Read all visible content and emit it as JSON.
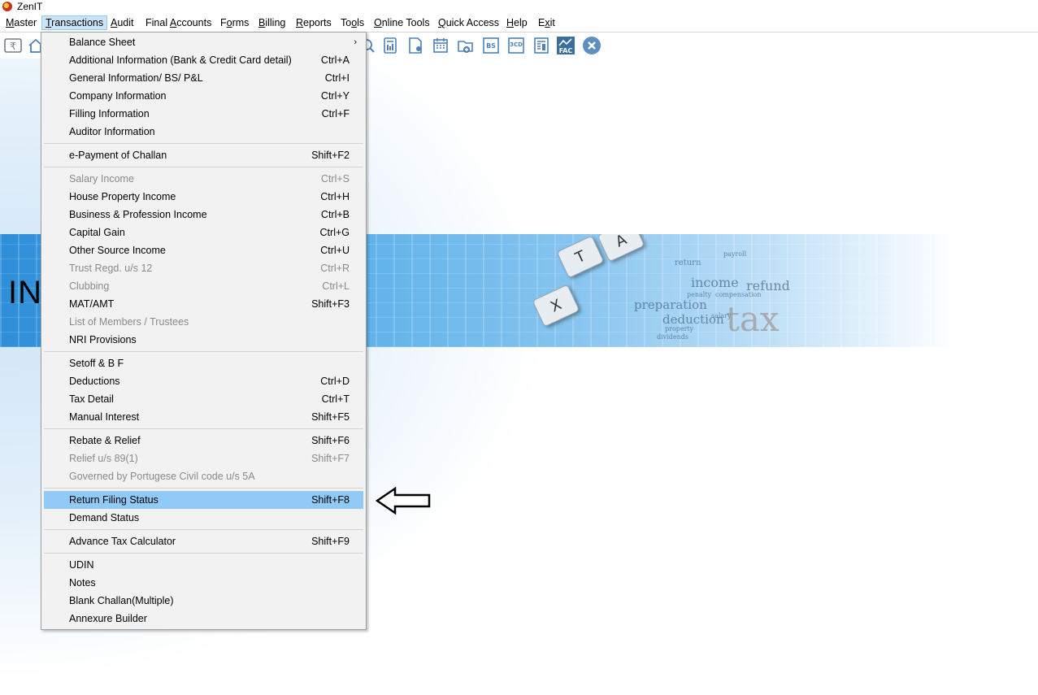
{
  "window": {
    "title": "ZenIT"
  },
  "menubar": [
    {
      "label": "Master",
      "u": "M"
    },
    {
      "label": "Transactions",
      "u": "T"
    },
    {
      "label": "Audit",
      "u": "A"
    },
    {
      "label": "Final Accounts",
      "u": "A"
    },
    {
      "label": "Forms",
      "u": "o"
    },
    {
      "label": "Billing",
      "u": "B"
    },
    {
      "label": "Reports",
      "u": "R"
    },
    {
      "label": "Tools",
      "u": "o"
    },
    {
      "label": "Online Tools",
      "u": "O"
    },
    {
      "label": "Quick Access",
      "u": "Q"
    },
    {
      "label": "Help",
      "u": "H"
    },
    {
      "label": "Exit",
      "u": "x"
    }
  ],
  "toolbar": {
    "icons": [
      "rupee-icon",
      "home-icon",
      "search-icon",
      "calculator-icon",
      "user-document-icon",
      "calendar-icon",
      "folder-add-icon",
      "bs-icon",
      "3cd-icon",
      "report-icon",
      "fac-icon",
      "close-circle-icon"
    ],
    "bs_label": "BS",
    "cd_label": "3CD",
    "fac_label": "FAC"
  },
  "banner": {
    "text": "INC",
    "keys": [
      "T",
      "A",
      "X"
    ],
    "words": [
      "income",
      "refund",
      "preparation",
      "deduction",
      "tax",
      "return",
      "salary",
      "payroll",
      "penalty",
      "compensation",
      "dividends",
      "property"
    ]
  },
  "transactions_menu": {
    "items": [
      {
        "label": "Balance Sheet",
        "shortcut": "",
        "submenu": true
      },
      {
        "label": "Additional Information (Bank & Credit Card detail)",
        "shortcut": "Ctrl+A"
      },
      {
        "label": "General Information/ BS/ P&L",
        "shortcut": "Ctrl+I"
      },
      {
        "label": "Company Information",
        "shortcut": "Ctrl+Y"
      },
      {
        "label": "Filling Information",
        "shortcut": "Ctrl+F"
      },
      {
        "label": "Auditor Information",
        "shortcut": ""
      },
      {
        "label": "e-Payment of Challan",
        "shortcut": "Shift+F2"
      },
      {
        "label": "Salary Income",
        "shortcut": "Ctrl+S",
        "disabled": true
      },
      {
        "label": "House Property Income",
        "shortcut": "Ctrl+H"
      },
      {
        "label": "Business & Profession Income",
        "shortcut": "Ctrl+B"
      },
      {
        "label": "Capital Gain",
        "shortcut": "Ctrl+G"
      },
      {
        "label": "Other Source Income",
        "shortcut": "Ctrl+U"
      },
      {
        "label": "Trust Regd. u/s 12",
        "shortcut": "Ctrl+R",
        "disabled": true
      },
      {
        "label": "Clubbing",
        "shortcut": "Ctrl+L",
        "disabled": true
      },
      {
        "label": "MAT/AMT",
        "shortcut": "Shift+F3"
      },
      {
        "label": "List of Members / Trustees",
        "shortcut": "",
        "disabled": true
      },
      {
        "label": "NRI Provisions",
        "shortcut": ""
      },
      {
        "label": "Setoff & B F",
        "shortcut": ""
      },
      {
        "label": "Deductions",
        "shortcut": "Ctrl+D"
      },
      {
        "label": "Tax Detail",
        "shortcut": "Ctrl+T"
      },
      {
        "label": "Manual Interest",
        "shortcut": "Shift+F5"
      },
      {
        "label": "Rebate & Relief",
        "shortcut": "Shift+F6"
      },
      {
        "label": "Relief u/s 89(1)",
        "shortcut": "Shift+F7",
        "disabled": true
      },
      {
        "label": "Governed by Portugese Civil code u/s 5A",
        "shortcut": "",
        "disabled": true
      },
      {
        "label": "Return Filing Status",
        "shortcut": "Shift+F8",
        "highlighted": true
      },
      {
        "label": "Demand Status",
        "shortcut": ""
      },
      {
        "label": "Advance Tax Calculator",
        "shortcut": "Shift+F9"
      },
      {
        "label": "UDIN",
        "shortcut": ""
      },
      {
        "label": "Notes",
        "shortcut": ""
      },
      {
        "label": "Blank Challan(Multiple)",
        "shortcut": ""
      },
      {
        "label": "Annexure Builder",
        "shortcut": ""
      }
    ]
  }
}
